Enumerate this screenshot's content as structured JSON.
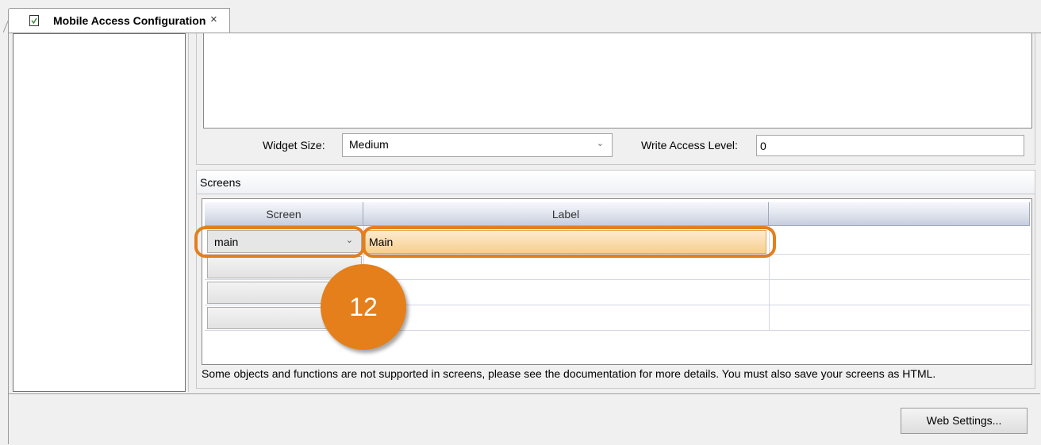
{
  "tab": {
    "icon": "document-icon",
    "title": "Mobile Access Configuration",
    "close_glyph": "×"
  },
  "widget": {
    "size_label": "Widget Size:",
    "size_value": "Medium",
    "write_access_label": "Write Access Level:",
    "write_access_value": "0"
  },
  "screens": {
    "header": "Screens",
    "columns": [
      "Screen",
      "Label",
      ""
    ],
    "rows": [
      {
        "screen": "main",
        "label": "Main"
      },
      {
        "screen": "",
        "label": ""
      },
      {
        "screen": "",
        "label": ""
      },
      {
        "screen": "",
        "label": ""
      }
    ],
    "note": "Some objects and functions are not supported in screens, please see the documentation for more details. You must also save your screens as HTML."
  },
  "callout": {
    "number": "12",
    "color": "#e47f1b"
  },
  "web_settings_label": "Web Settings..."
}
